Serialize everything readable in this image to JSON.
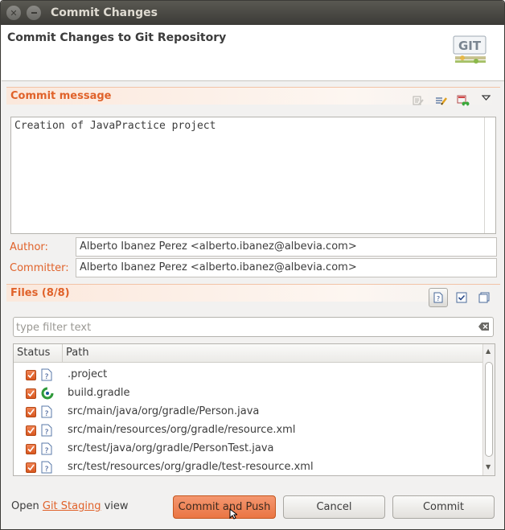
{
  "window": {
    "title": "Commit Changes"
  },
  "header": {
    "title": "Commit Changes to Git Repository",
    "logo_text": "GIT"
  },
  "commit_message": {
    "section_title": "Commit message",
    "text": "Creation of JavaPractice project",
    "toolbar_icons": [
      "spell-check-icon",
      "edit-icon",
      "signed-off-icon",
      "dropdown-menu-icon"
    ]
  },
  "author": {
    "label": "Author:",
    "value": "Alberto Ibanez Perez <alberto.ibanez@albevia.com>"
  },
  "committer": {
    "label": "Committer:",
    "value": "Alberto Ibanez Perez <alberto.ibanez@albevia.com>"
  },
  "files": {
    "section_title": "Files (8/8)",
    "toolbar_icons": [
      "show-untracked-icon",
      "select-all-icon",
      "deselect-all-icon"
    ],
    "filter_placeholder": "type filter text",
    "columns": [
      "Status",
      "Path"
    ],
    "rows": [
      {
        "path": ".project",
        "checked": true,
        "icon": "untracked-file-icon"
      },
      {
        "path": "build.gradle",
        "checked": true,
        "icon": "gradle-file-icon"
      },
      {
        "path": "src/main/java/org/gradle/Person.java",
        "checked": true,
        "icon": "untracked-file-icon"
      },
      {
        "path": "src/main/resources/org/gradle/resource.xml",
        "checked": true,
        "icon": "untracked-file-icon"
      },
      {
        "path": "src/test/java/org/gradle/PersonTest.java",
        "checked": true,
        "icon": "untracked-file-icon"
      },
      {
        "path": "src/test/resources/org/gradle/test-resource.xml",
        "checked": true,
        "icon": "untracked-file-icon"
      }
    ]
  },
  "footer": {
    "open_text": "Open",
    "link_text": "Git Staging",
    "view_text": "view",
    "commit_and_push_label": "Commit and Push",
    "cancel_label": "Cancel",
    "commit_label": "Commit"
  },
  "colors": {
    "accent": "#e0622a",
    "primary_button": "#ea7543",
    "titlebar": "#3c3b37"
  }
}
